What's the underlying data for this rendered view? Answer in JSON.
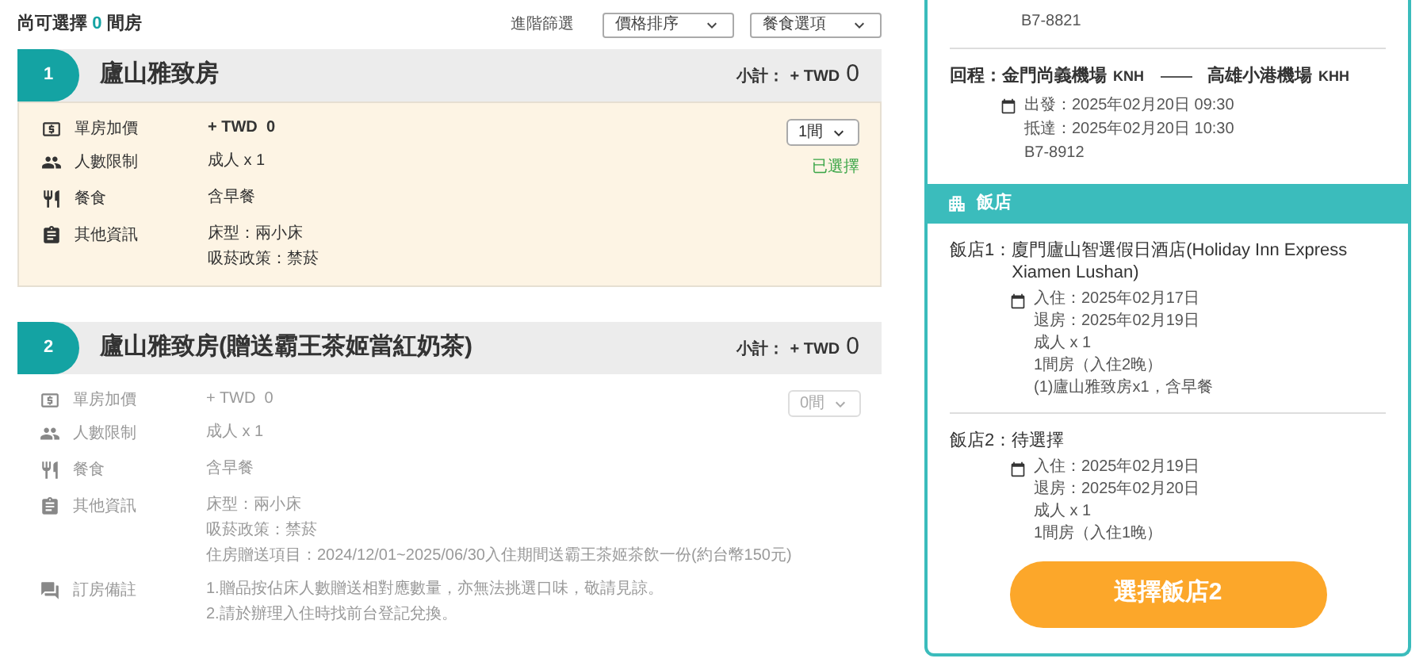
{
  "header": {
    "title_prefix": "尚可選擇",
    "count": "0",
    "title_suffix": "間房",
    "filter_label": "進階篩選",
    "dropdowns": [
      {
        "value": "價格排序"
      },
      {
        "value": "餐食選項"
      }
    ]
  },
  "rooms": [
    {
      "index": "1",
      "name": "廬山雅致房",
      "subtotal_label": "小計：",
      "subtotal_currency": "+ TWD",
      "subtotal_value": "0",
      "selected": true,
      "quantity": "1間",
      "status": "已選擇",
      "details": [
        {
          "kind": "price",
          "label": "單房加價",
          "lines": [
            "+ TWD  0"
          ]
        },
        {
          "kind": "people",
          "label": "人數限制",
          "lines": [
            "成人 x 1"
          ]
        },
        {
          "kind": "meal",
          "label": "餐食",
          "lines": [
            "含早餐"
          ]
        },
        {
          "kind": "info",
          "label": "其他資訊",
          "lines": [
            "床型：兩小床",
            "吸菸政策：禁菸"
          ]
        }
      ]
    },
    {
      "index": "2",
      "name": "廬山雅致房(贈送霸王茶姬當紅奶茶)",
      "subtotal_label": "小計：",
      "subtotal_currency": "+ TWD",
      "subtotal_value": "0",
      "selected": false,
      "quantity": "0間",
      "details": [
        {
          "kind": "price",
          "label": "單房加價",
          "lines": [
            "+ TWD  0"
          ]
        },
        {
          "kind": "people",
          "label": "人數限制",
          "lines": [
            "成人 x 1"
          ]
        },
        {
          "kind": "meal",
          "label": "餐食",
          "lines": [
            "含早餐"
          ]
        },
        {
          "kind": "info",
          "label": "其他資訊",
          "lines": [
            "床型：兩小床",
            "吸菸政策：禁菸",
            "住房贈送項目：2024/12/01~2025/06/30入住期間送霸王茶姬茶飲一份(約台幣150元)"
          ]
        },
        {
          "kind": "note",
          "label": "訂房備註",
          "lines": [
            "1.贈品按佔床人數贈送相對應數量，亦無法挑選口味，敬請見諒。",
            "2.請於辦理入住時找前台登記兌換。"
          ]
        }
      ]
    }
  ],
  "summary": {
    "flight_number": "B7-8821",
    "return_flight": {
      "label": "回程：",
      "from": "金門尚義機場",
      "from_code": "KNH",
      "to": "高雄小港機場",
      "to_code": "KHH",
      "lines": [
        "出發：2025年02月20日 09:30",
        "抵達：2025年02月20日 10:30",
        "B7-8912"
      ]
    },
    "hotel_section": "飯店",
    "hotels": [
      {
        "label": "飯店1：",
        "name": "廈門廬山智選假日酒店(Holiday Inn Express Xiamen Lushan)",
        "lines": [
          "入住：2025年02月17日",
          "退房：2025年02月19日",
          "成人 x 1",
          "1間房（入住2晚）",
          "(1)廬山雅致房x1，含早餐"
        ]
      },
      {
        "label": "飯店2：",
        "name": "待選擇",
        "lines": [
          "入住：2025年02月19日",
          "退房：2025年02月20日",
          "成人 x 1",
          "1間房（入住1晚）"
        ]
      }
    ],
    "button": "選擇飯店2"
  }
}
